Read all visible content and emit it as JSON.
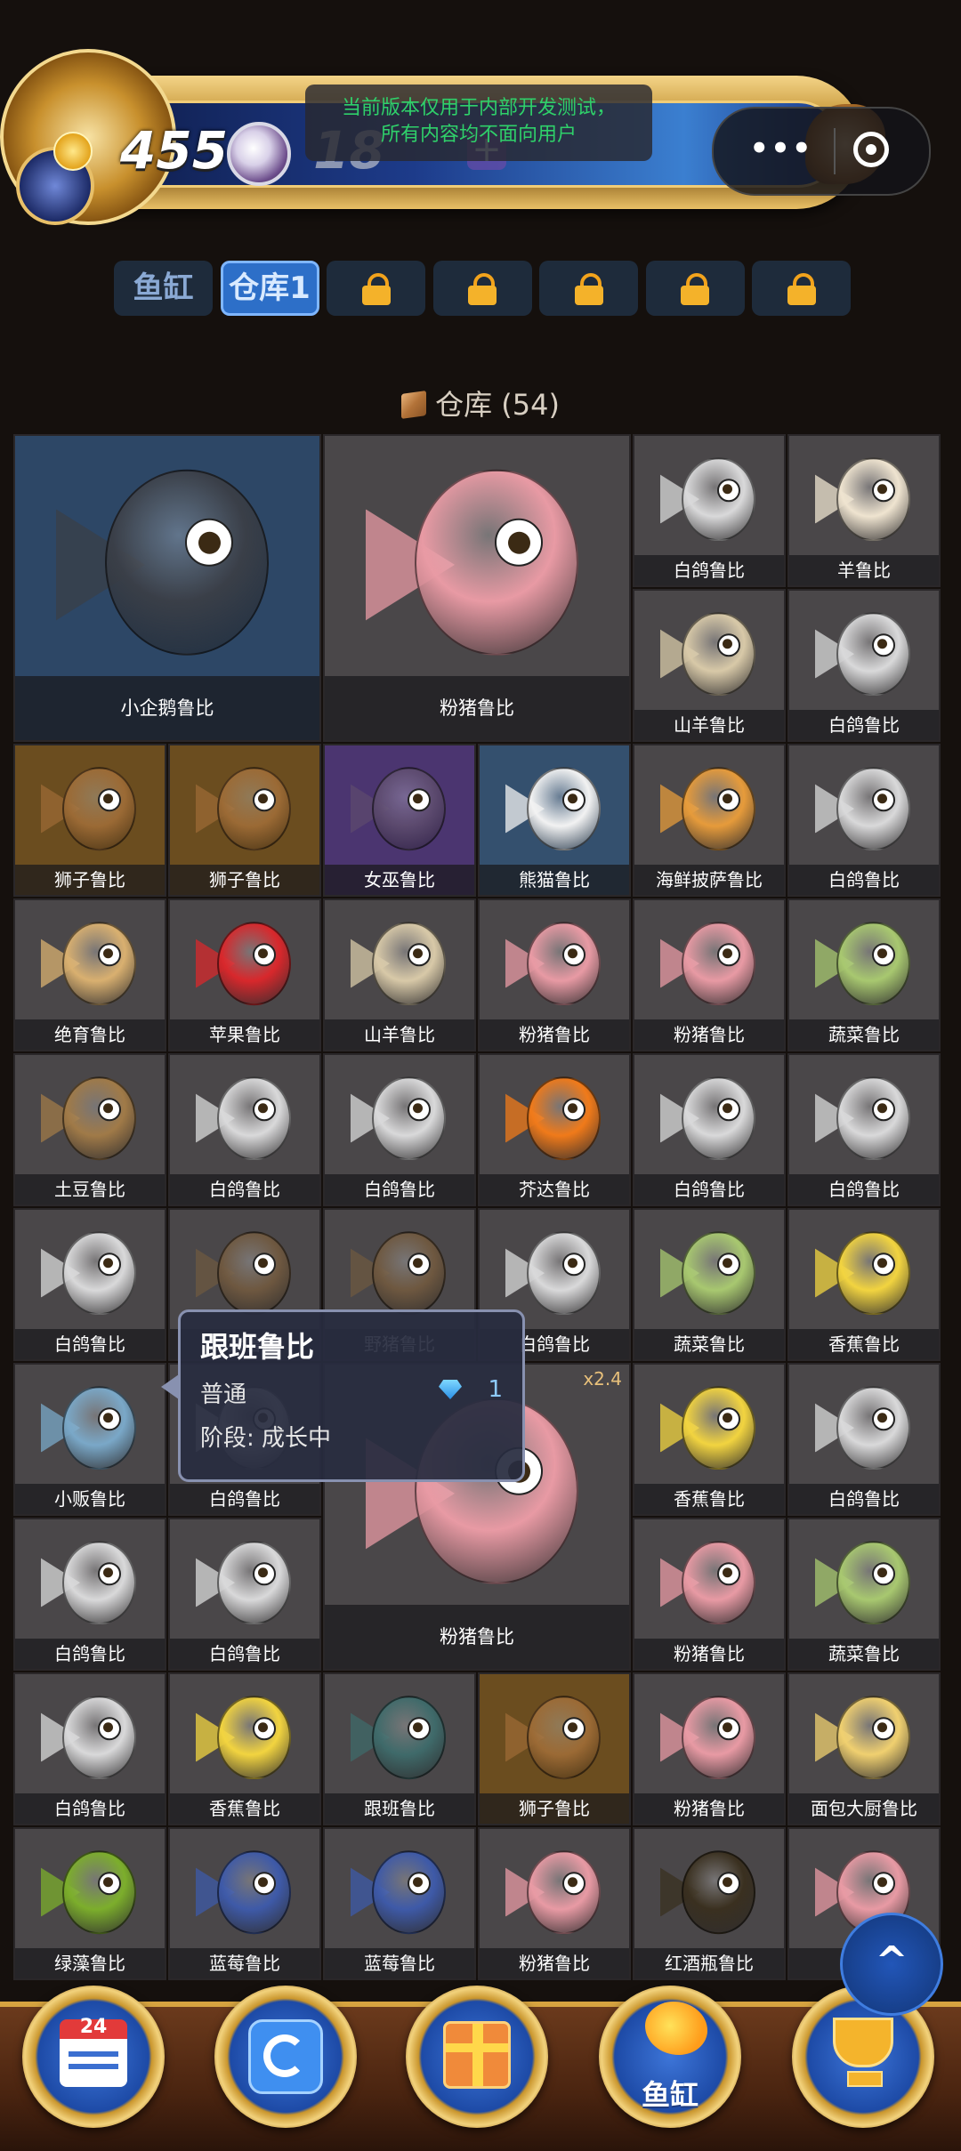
{
  "header": {
    "coin_amount": "455",
    "pearl_amount": "18",
    "plus_label": "+",
    "dev_notice_line1": "当前版本仅用于内部开发测试，",
    "dev_notice_line2": "所有内容均不面向用户",
    "more_label": "•••"
  },
  "tabs": [
    {
      "label": "鱼缸",
      "locked": false,
      "active": false
    },
    {
      "label": "仓库1",
      "locked": false,
      "active": true
    },
    {
      "label": "",
      "locked": true
    },
    {
      "label": "",
      "locked": true
    },
    {
      "label": "",
      "locked": true
    },
    {
      "label": "",
      "locked": true
    },
    {
      "label": "",
      "locked": true
    }
  ],
  "storage": {
    "title": "仓库 (54)"
  },
  "grid_items": [
    {
      "name": "小企鹅鲁比",
      "bg": "blue",
      "color": "#3a3f48",
      "size": "big"
    },
    {
      "name": "粉猪鲁比",
      "bg": "gray",
      "color": "#e89aa4",
      "size": "big"
    },
    {
      "name": "白鸽鲁比",
      "bg": "gray",
      "color": "#d9d9da"
    },
    {
      "name": "羊鲁比",
      "bg": "gray",
      "color": "#efe4d0"
    },
    {
      "name": "山羊鲁比",
      "bg": "gray",
      "color": "#d8c9a8"
    },
    {
      "name": "白鸽鲁比",
      "bg": "gray",
      "color": "#d9d9da"
    },
    {
      "name": "狮子鲁比",
      "bg": "gold",
      "color": "#9b6a35"
    },
    {
      "name": "狮子鲁比",
      "bg": "gold",
      "color": "#9b6a35"
    },
    {
      "name": "女巫鲁比",
      "bg": "purple",
      "color": "#5c4a6e"
    },
    {
      "name": "熊猫鲁比",
      "bg": "lblue",
      "color": "#f2f2f2"
    },
    {
      "name": "海鲜披萨鲁比",
      "bg": "gray",
      "color": "#e69b3b"
    },
    {
      "name": "白鸽鲁比",
      "bg": "gray",
      "color": "#d9d9da"
    },
    {
      "name": "绝育鲁比",
      "bg": "gray",
      "color": "#d9b070"
    },
    {
      "name": "苹果鲁比",
      "bg": "gray",
      "color": "#d8282c"
    },
    {
      "name": "山羊鲁比",
      "bg": "gray",
      "color": "#d8c9a8"
    },
    {
      "name": "粉猪鲁比",
      "bg": "gray",
      "color": "#e89aa4"
    },
    {
      "name": "粉猪鲁比",
      "bg": "gray",
      "color": "#e89aa4"
    },
    {
      "name": "蔬菜鲁比",
      "bg": "gray",
      "color": "#a8c870"
    },
    {
      "name": "土豆鲁比",
      "bg": "gray",
      "color": "#a07a48"
    },
    {
      "name": "白鸽鲁比",
      "bg": "gray",
      "color": "#d9d9da"
    },
    {
      "name": "白鸽鲁比",
      "bg": "gray",
      "color": "#d9d9da"
    },
    {
      "name": "芥达鲁比",
      "bg": "gray",
      "color": "#f07a1a"
    },
    {
      "name": "白鸽鲁比",
      "bg": "gray",
      "color": "#d9d9da"
    },
    {
      "name": "白鸽鲁比",
      "bg": "gray",
      "color": "#d9d9da"
    },
    {
      "name": "白鸽鲁比",
      "bg": "gray",
      "color": "#d9d9da"
    },
    {
      "name": "野猪鲁比",
      "bg": "gray",
      "color": "#6e5840"
    },
    {
      "name": "野猪鲁比",
      "bg": "gray",
      "color": "#6e5840"
    },
    {
      "name": "白鸽鲁比",
      "bg": "gray",
      "color": "#d9d9da"
    },
    {
      "name": "蔬菜鲁比",
      "bg": "gray",
      "color": "#a8c870"
    },
    {
      "name": "香蕉鲁比",
      "bg": "gray",
      "color": "#f2d440"
    },
    {
      "name": "小贩鲁比",
      "bg": "gray",
      "color": "#7aa8c8"
    },
    {
      "name": "白鸽鲁比",
      "bg": "gray",
      "color": "#d9d9da"
    },
    {
      "name": "粉猪鲁比",
      "bg": "gray",
      "color": "#e89aa4",
      "size": "big",
      "multiplier": "x2.4"
    },
    {
      "name": "香蕉鲁比",
      "bg": "gray",
      "color": "#f2d440"
    },
    {
      "name": "白鸽鲁比",
      "bg": "gray",
      "color": "#d9d9da"
    },
    {
      "name": "白鸽鲁比",
      "bg": "gray",
      "color": "#d9d9da"
    },
    {
      "name": "白鸽鲁比",
      "bg": "gray",
      "color": "#d9d9da"
    },
    {
      "name": "粉猪鲁比",
      "bg": "gray",
      "color": "#e89aa4"
    },
    {
      "name": "蔬菜鲁比",
      "bg": "gray",
      "color": "#a8c870"
    },
    {
      "name": "白鸽鲁比",
      "bg": "gray",
      "color": "#d9d9da"
    },
    {
      "name": "香蕉鲁比",
      "bg": "gray",
      "color": "#f2d440"
    },
    {
      "name": "跟班鲁比",
      "bg": "gray",
      "color": "#3f6a6a"
    },
    {
      "name": "狮子鲁比",
      "bg": "gold",
      "color": "#9b6a35"
    },
    {
      "name": "粉猪鲁比",
      "bg": "gray",
      "color": "#e89aa4"
    },
    {
      "name": "面包大厨鲁比",
      "bg": "gray",
      "color": "#f0d070"
    },
    {
      "name": "绿藻鲁比",
      "bg": "gray",
      "color": "#7cae2c"
    },
    {
      "name": "蓝莓鲁比",
      "bg": "gray",
      "color": "#3e5aa8"
    },
    {
      "name": "蓝莓鲁比",
      "bg": "gray",
      "color": "#3e5aa8"
    },
    {
      "name": "粉猪鲁比",
      "bg": "gray",
      "color": "#e89aa4"
    },
    {
      "name": "红酒瓶鲁比",
      "bg": "gray",
      "color": "#3a3020"
    },
    {
      "name": "粉",
      "bg": "gray",
      "color": "#e89aa4"
    }
  ],
  "tooltip": {
    "name": "跟班鲁比",
    "rarity": "普通",
    "gem_count": "1",
    "stage": "阶段: 成长中"
  },
  "scroll_top_label": "^",
  "bottom_nav": [
    {
      "id": "calendar",
      "label": "",
      "calendar_number": "24"
    },
    {
      "id": "refresh",
      "label": ""
    },
    {
      "id": "gift",
      "label": ""
    },
    {
      "id": "fishtank",
      "label": "鱼缸"
    },
    {
      "id": "trophy",
      "label": ""
    }
  ],
  "colors": {
    "accent": "#2d6fc8",
    "lock": "#f4b22a",
    "notice_text": "#2fd06a",
    "gold_frame": "#d6a340"
  }
}
